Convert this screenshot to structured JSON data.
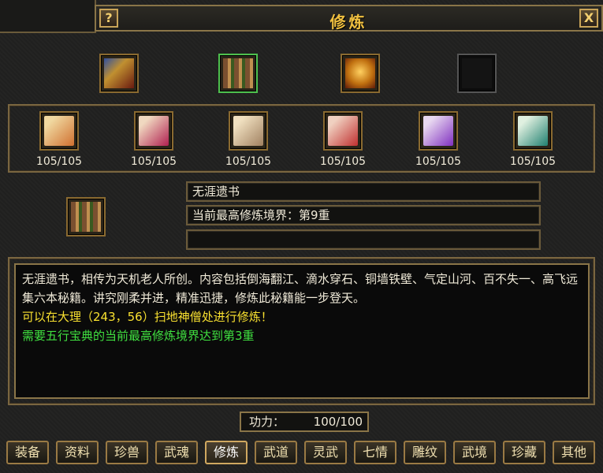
{
  "window": {
    "title": "修炼",
    "help_label": "?",
    "close_label": "X"
  },
  "top_books": [
    {
      "name": "golden-book-icon",
      "selected": false
    },
    {
      "name": "scroll-bundle-icon",
      "selected": true
    },
    {
      "name": "treasure-book-icon",
      "selected": false
    },
    {
      "name": "empty-slot",
      "selected": false
    }
  ],
  "scrolls": [
    {
      "icon": "scroll-orange-icon",
      "count": "105/105",
      "color": "#d07030"
    },
    {
      "icon": "scroll-crimson-icon",
      "count": "105/105",
      "color": "#b02050"
    },
    {
      "icon": "scroll-tan-icon",
      "count": "105/105",
      "color": "#a08060"
    },
    {
      "icon": "scroll-red-icon",
      "count": "105/105",
      "color": "#c03030"
    },
    {
      "icon": "scroll-purple-icon",
      "count": "105/105",
      "color": "#8030c0"
    },
    {
      "icon": "scroll-teal-icon",
      "count": "105/105",
      "color": "#208070"
    }
  ],
  "selected": {
    "icon": "scroll-bundle-icon",
    "name": "无涯遗书",
    "realm": "当前最高修炼境界：第9重",
    "extra": ""
  },
  "description": {
    "line1": "无涯遗书，相传为天机老人所创。内容包括倒海翻江、滴水穿石、铜墙铁壁、气定山河、百不失一、高飞远集六本秘籍。讲究刚柔并进，精准迅捷，修炼此秘籍能一步登天。",
    "location": "可以在大理（243，56）扫地神僧处进行修炼！",
    "requirement": "需要五行宝典的当前最高修炼境界达到第3重"
  },
  "power": {
    "label": "功力：",
    "value": "100/100"
  },
  "tabs": [
    "装备",
    "资料",
    "珍兽",
    "武魂",
    "修炼",
    "武道",
    "灵武",
    "七情",
    "雕纹",
    "武境",
    "珍藏",
    "其他"
  ],
  "active_tab": "修炼"
}
